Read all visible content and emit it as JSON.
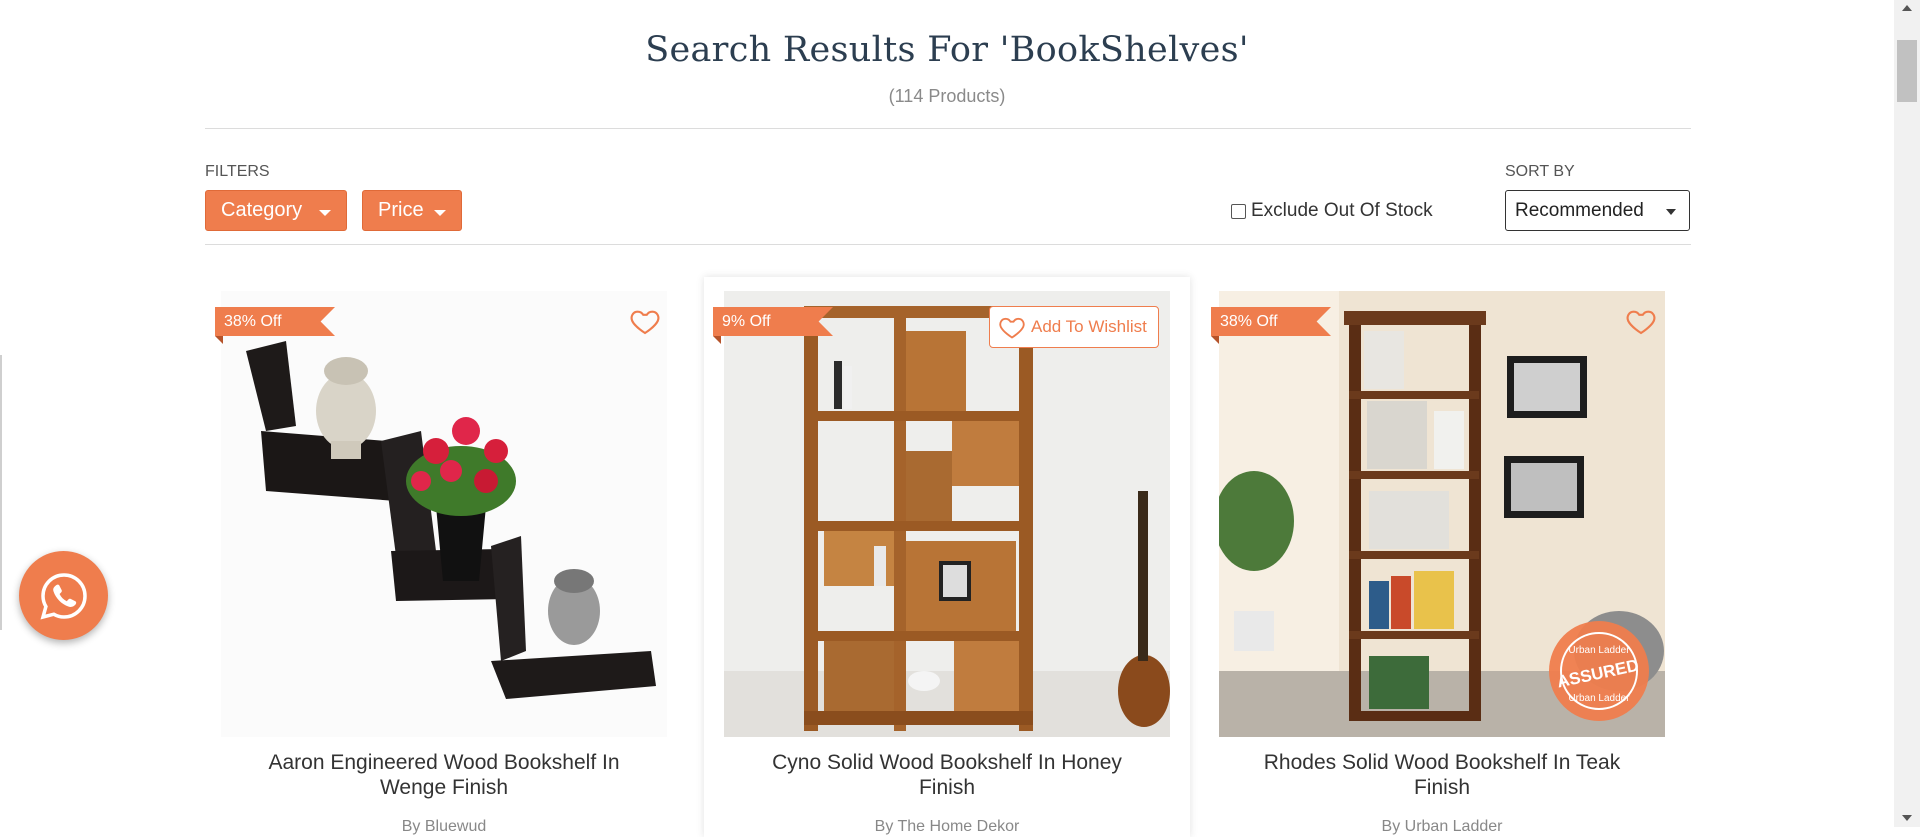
{
  "header": {
    "title": "Search Results For 'BookShelves'",
    "product_count": "(114 Products)"
  },
  "filters": {
    "label": "FILTERS",
    "category_label": "Category",
    "price_label": "Price",
    "exclude_out_of_stock_label": "Exclude Out Of Stock",
    "exclude_out_of_stock_checked": false
  },
  "sort": {
    "label": "SORT BY",
    "selected": "Recommended"
  },
  "products": [
    {
      "discount": "38% Off",
      "name_line1": "Aaron Engineered Wood Bookshelf In",
      "name_line2": "Wenge Finish",
      "seller": "By Bluewud"
    },
    {
      "discount": "9% Off",
      "name_line1": "Cyno Solid Wood Bookshelf In Honey",
      "name_line2": "Finish",
      "seller": "By The Home Dekor",
      "wishlist_label": "Add To Wishlist"
    },
    {
      "discount": "38% Off",
      "name_line1": "Rhodes Solid Wood Bookshelf In Teak",
      "name_line2": "Finish",
      "seller": "By Urban Ladder",
      "badge_top": "Urban Ladder",
      "badge_main": "ASSURED",
      "badge_bottom": "Urban Ladder"
    }
  ],
  "colors": {
    "accent": "#ef7d4d",
    "title": "#2c3e50"
  },
  "icons": [
    "heart-icon",
    "whatsapp-icon",
    "chevron-down-icon"
  ]
}
